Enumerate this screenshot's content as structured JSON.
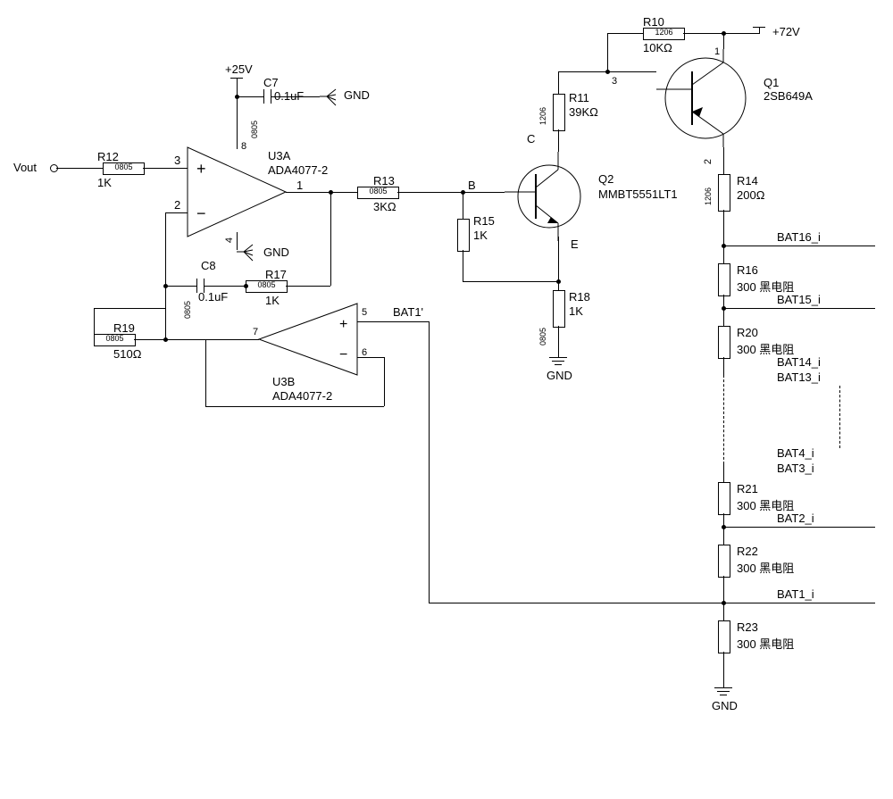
{
  "supply": {
    "v25": "+25V",
    "v72": "+72V",
    "gnd": "GND",
    "vout": "Vout"
  },
  "opamps": {
    "u3a": {
      "name": "U3A",
      "model": "ADA4077-2"
    },
    "u3b": {
      "name": "U3B",
      "model": "ADA4077-2"
    }
  },
  "transistors": {
    "q1": {
      "name": "Q1",
      "model": "2SB649A"
    },
    "q2": {
      "name": "Q2",
      "model": "MMBT5551LT1"
    }
  },
  "caps": {
    "c7": {
      "name": "C7",
      "value": "0.1uF"
    },
    "c8": {
      "name": "C8",
      "value": "0.1uF"
    }
  },
  "resistors": {
    "r10": {
      "name": "R10",
      "pkg": "1206",
      "value": "10KΩ"
    },
    "r11": {
      "name": "R11",
      "pkg": "1206",
      "value": "39KΩ"
    },
    "r12": {
      "name": "R12",
      "pkg": "0805",
      "value": "1K"
    },
    "r13": {
      "name": "R13",
      "pkg": "0805",
      "value": "3KΩ"
    },
    "r14": {
      "name": "R14",
      "pkg": "1206",
      "value": "200Ω"
    },
    "r15": {
      "name": "R15",
      "value": "1K"
    },
    "r16": {
      "name": "R16",
      "value": "300 黑电阻"
    },
    "r17": {
      "name": "R17",
      "pkg": "0805",
      "value": "1K"
    },
    "r18": {
      "name": "R18",
      "pkg": "0805",
      "value": "1K"
    },
    "r19": {
      "name": "R19",
      "pkg": "0805",
      "value": "510Ω"
    },
    "r20": {
      "name": "R20",
      "value": "300 黑电阻"
    },
    "r21": {
      "name": "R21",
      "value": "300 黑电阻"
    },
    "r22": {
      "name": "R22",
      "value": "300 黑电阻"
    },
    "r23": {
      "name": "R23",
      "value": "300 黑电阻"
    }
  },
  "pins": {
    "p1": "1",
    "p2": "2",
    "p3": "3",
    "p4": "4",
    "p5": "5",
    "p6": "6",
    "p7": "7",
    "p8": "8",
    "b": "B",
    "c": "C",
    "e": "E"
  },
  "pkgs": {
    "p0805": "0805",
    "p1206": "1206"
  },
  "nets": {
    "bat1p": "BAT1'",
    "bat16i": "BAT16_i",
    "bat15i": "BAT15_i",
    "bat14i": "BAT14_i",
    "bat13i": "BAT13_i",
    "bat4i": "BAT4_i",
    "bat3i": "BAT3_i",
    "bat2i": "BAT2_i",
    "bat1i": "BAT1_i"
  }
}
